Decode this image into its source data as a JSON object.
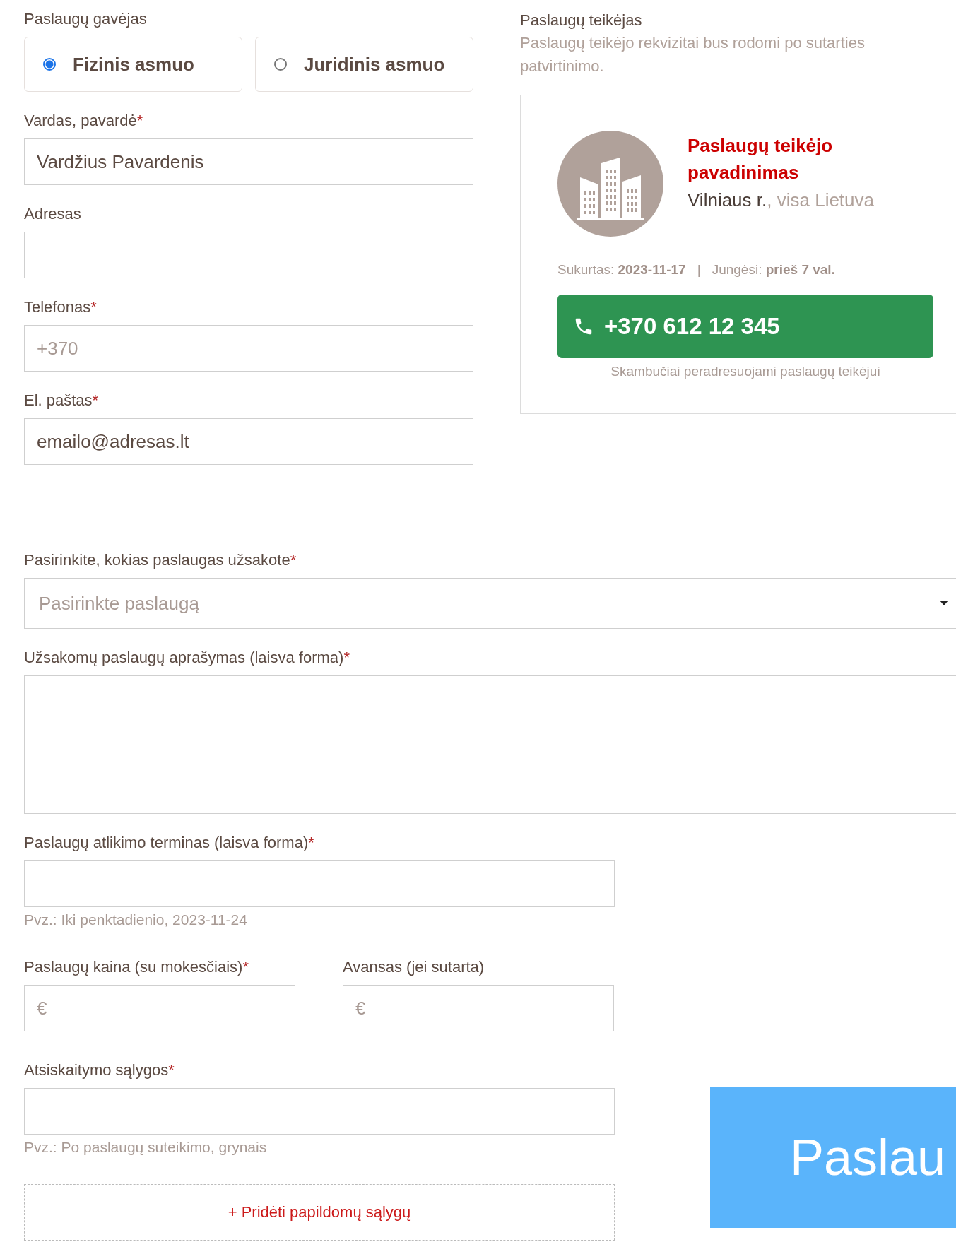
{
  "recipient": {
    "title": "Paslaugų gavėjas",
    "types": [
      {
        "label": "Fizinis asmuo",
        "selected": true
      },
      {
        "label": "Juridinis asmuo",
        "selected": false
      }
    ],
    "fields": [
      {
        "label": "Vardas, pavardė",
        "mark": "*",
        "value": "Vardžius Pavardenis"
      },
      {
        "label": "Adresas"
      },
      {
        "label": "Telefonas",
        "mark": "*",
        "placeholder": "+370"
      },
      {
        "label": "El. paštas",
        "mark": "*",
        "value": "emailo@adresas.lt"
      }
    ]
  },
  "provider": {
    "title": "Paslaugų teikėjas",
    "note": "Paslaugų teikėjo rekvizitai bus rodomi po sutarties patvirtinimo.",
    "card": {
      "name": "Paslaugų teikėjo pavadinimas",
      "location": "Vilniaus r.",
      "area": ", visa Lietuva",
      "created_label": "Sukurtas:",
      "created": "2023-11-17",
      "separator": "|",
      "online_label": "Jungėsi:",
      "online": "prieš 7 val.",
      "phone": "+370 612 12 345",
      "caption": "Skambučiai peradresuojami paslaugų teikėjui"
    }
  },
  "order": {
    "service": {
      "label": "Pasirinkite, kokias paslaugas užsakote",
      "mark": "*",
      "placeholder": "Pasirinkte paslaugą"
    },
    "description": {
      "label": "Užsakomų paslaugų aprašymas (laisva forma)",
      "mark": "*"
    },
    "term": {
      "label": "Paslaugų atlikimo terminas (laisva forma)",
      "mark": "*",
      "hint": "Pvz.: Iki penktadienio, 2023-11-24"
    },
    "price": {
      "label": "Paslaugų kaina (su mokesčiais)",
      "mark": "*",
      "placeholder": "€"
    },
    "advance": {
      "label": "Avansas (jei sutarta)",
      "placeholder": "€"
    },
    "payment": {
      "label": "Atsiskaitymo sąlygos",
      "mark": "*",
      "hint": "Pvz.: Po paslaugų suteikimo, grynais"
    },
    "add_conditions": "+ Pridėti papildomų sąlygų"
  },
  "submit": {
    "label": "Paslau"
  }
}
